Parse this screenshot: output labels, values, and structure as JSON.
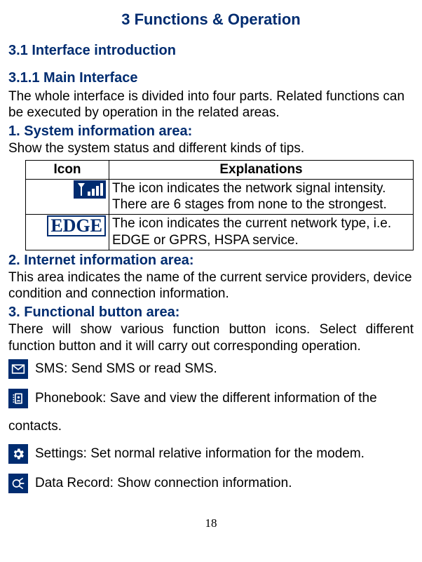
{
  "chapterTitle": "3 Functions & Operation",
  "sec31": "3.1 Interface introduction",
  "sec311": "3.1.1 Main Interface",
  "introText": "The whole interface is divided into four parts. Related functions can be executed by operation in the related areas.",
  "area1": {
    "heading": "1. System information area:",
    "desc": "Show the system status and different kinds of tips.",
    "table": {
      "hIcon": "Icon",
      "hExpl": "Explanations",
      "row1Expl": "The icon indicates the network signal intensity. There are 6 stages from none to the strongest.",
      "row2IconText": "EDGE",
      "row2Expl": "The icon indicates the current network type, i.e. EDGE or GPRS, HSPA service."
    }
  },
  "area2": {
    "heading": "2. Internet information area:",
    "desc": "This area indicates the name of the current service providers, device condition and connection information."
  },
  "area3": {
    "heading": "3. Functional button area:",
    "desc": "There will show various function button icons. Select different function button and it will carry out corresponding operation.",
    "sms": "SMS: Send SMS or read SMS.",
    "phonebookLine": "Phonebook: Save and view the different information of the",
    "phonebookCont": "contacts.",
    "settings": "Settings: Set normal relative information for the modem.",
    "dataRecord": "Data Record: Show connection information."
  },
  "pageNumber": "18"
}
